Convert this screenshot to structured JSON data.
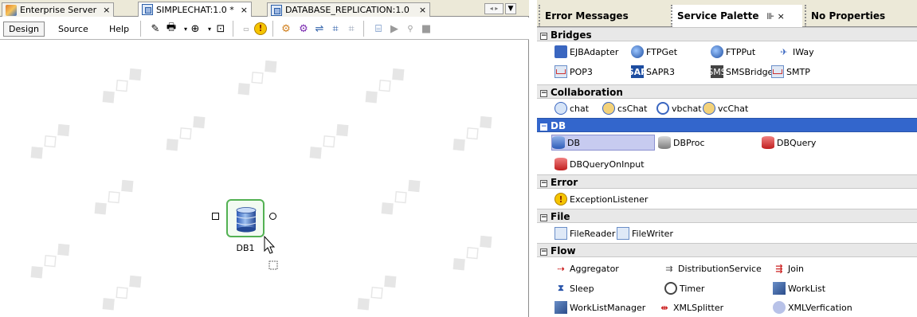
{
  "editor": {
    "tabs": [
      {
        "label": "Enterprise Server",
        "close": "×",
        "icon": "enterprise-server-icon"
      },
      {
        "label": "SIMPLECHAT:1.0 *",
        "close": "×",
        "icon": "project-icon"
      },
      {
        "label": "DATABASE_REPLICATION:1.0",
        "close": "×",
        "icon": "project-icon"
      }
    ],
    "toolbar": {
      "design": "Design",
      "source": "Source",
      "help": "Help"
    },
    "canvas": {
      "node_label": "DB1"
    }
  },
  "palette": {
    "tabs": {
      "errors": "Error Messages",
      "service": "Service Palette",
      "service_controls": "⊪ ×",
      "props": "No Properties"
    },
    "categories": {
      "bridges": "Bridges",
      "collaboration": "Collaboration",
      "db": "DB",
      "error": "Error",
      "file": "File",
      "flow": "Flow"
    },
    "items": {
      "ejbadapter": "EJBAdapter",
      "ftpget": "FTPGet",
      "ftpput": "FTPPut",
      "iway": "IWay",
      "pop3": "POP3",
      "sapr3": "SAPR3",
      "smsbridge": "SMSBridge",
      "smtp": "SMTP",
      "chat": "chat",
      "cschat": "csChat",
      "vbchat": "vbchat",
      "vcchat": "vcChat",
      "db": "DB",
      "dbproc": "DBProc",
      "dbquery": "DBQuery",
      "dbqueryoninput": "DBQueryOnInput",
      "exceptionlistener": "ExceptionListener",
      "filereader": "FileReader",
      "filewriter": "FileWriter",
      "aggregator": "Aggregator",
      "distributionservice": "DistributionService",
      "join": "Join",
      "sleep": "Sleep",
      "timer": "Timer",
      "worklist": "WorkList",
      "worklistmanager": "WorkListManager",
      "xmlsplitter": "XMLSplitter",
      "xmlverfication": "XMLVerfication"
    },
    "selected_item": "DB",
    "selected_category": "DB"
  },
  "colors": {
    "category_selected": "#3366cc",
    "item_selected": "#c7cbf0",
    "node_border": "#53b153"
  }
}
